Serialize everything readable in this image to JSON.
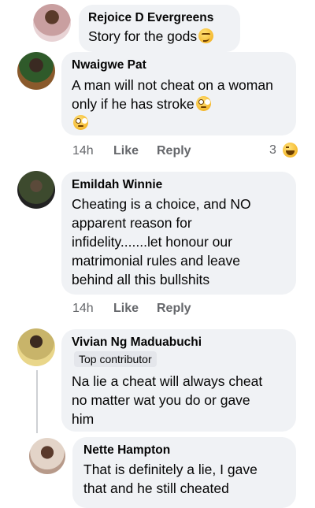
{
  "comments": [
    {
      "author": "Rejoice D Evergreens",
      "text": "Story for the gods",
      "emoji": "smirking-face"
    },
    {
      "author": "Nwaigwe Pat",
      "text": "A man will not cheat on a woman only if he has stroke",
      "emoji": "face-with-rolling-eyes",
      "time": "14h",
      "like_label": "Like",
      "reply_label": "Reply",
      "reaction_count": "3",
      "reaction_emoji": "grinning-squinting-face"
    },
    {
      "author": "Emildah Winnie",
      "text_lines": [
        "Cheating is a choice, and NO",
        "apparent reason for",
        "infidelity.......let honour our",
        "matrimonial rules and leave",
        "behind all this bullshits"
      ],
      "time": "14h",
      "like_label": "Like",
      "reply_label": "Reply"
    },
    {
      "author": "Vivian Ng Maduabuchi",
      "badge": "Top contributor",
      "text_lines": [
        "Na lie a cheat will always cheat",
        "no matter wat you do or gave",
        "him"
      ]
    },
    {
      "author": "Nette Hampton",
      "text_lines": [
        "That is definitely a lie, I gave",
        "that and he still cheated"
      ]
    }
  ],
  "colors": {
    "bubble": "#f0f2f5",
    "meta": "#65676b",
    "badge": "#e4e6eb"
  }
}
